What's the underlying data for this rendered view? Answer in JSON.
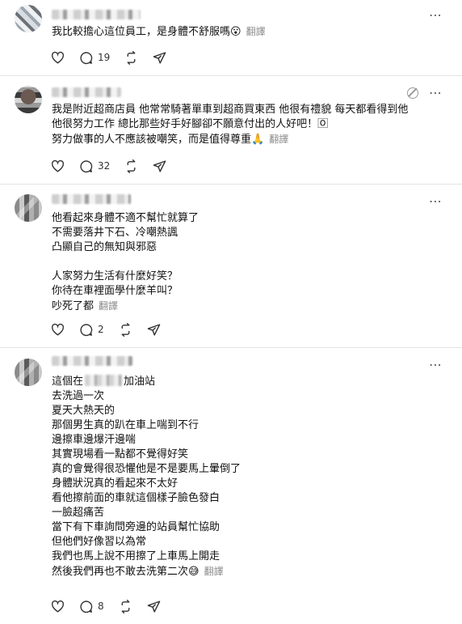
{
  "ui": {
    "translate_label": "翻譯",
    "more_icon": "⋯"
  },
  "posts": [
    {
      "lines": [
        "我比較擔心這位員工，是身體不舒服嗎😮"
      ],
      "counts": {
        "replies": "19"
      }
    },
    {
      "lines": [
        "我是附近超商店員 他常常騎著單車到超商買東西 他很有禮貌 每天都看得到他",
        "他很努力工作 總比那些好手好腳卻不願意付出的人好吧！🄾",
        "努力做事的人不應該被嘲笑，而是值得尊重🙏"
      ],
      "counts": {
        "replies": "32"
      }
    },
    {
      "lines": [
        "他看起來身體不適不幫忙就算了",
        "不需要落井下石、冷嘲熱諷",
        "凸顯自己的無知與邪惡",
        "",
        "人家努力生活有什麼好笑？",
        "你待在車裡面學什麼羊叫？",
        "吵死了都"
      ],
      "counts": {
        "replies": "2"
      }
    },
    {
      "first_line_start": "這個在",
      "first_line_end": "加油站",
      "lines": [
        "去洗過一次",
        "夏天大熱天的",
        "那個男生真的趴在車上喘到不行",
        "邊擦車邊爆汗邊喘",
        "其實現場看一點都不覺得好笑",
        "真的會覺得很恐懼他是不是要馬上暈倒了",
        "身體狀況真的看起來不太好",
        "看他擦前面的車就這個樣子臉色發白",
        "一臉超痛苦",
        "當下有下車詢問旁邊的站員幫忙協助",
        "但他們好像習以為常",
        "我們也馬上說不用擦了上車馬上開走",
        "然後我們再也不敢去洗第二次😅"
      ],
      "counts": {
        "replies": "8"
      }
    }
  ]
}
